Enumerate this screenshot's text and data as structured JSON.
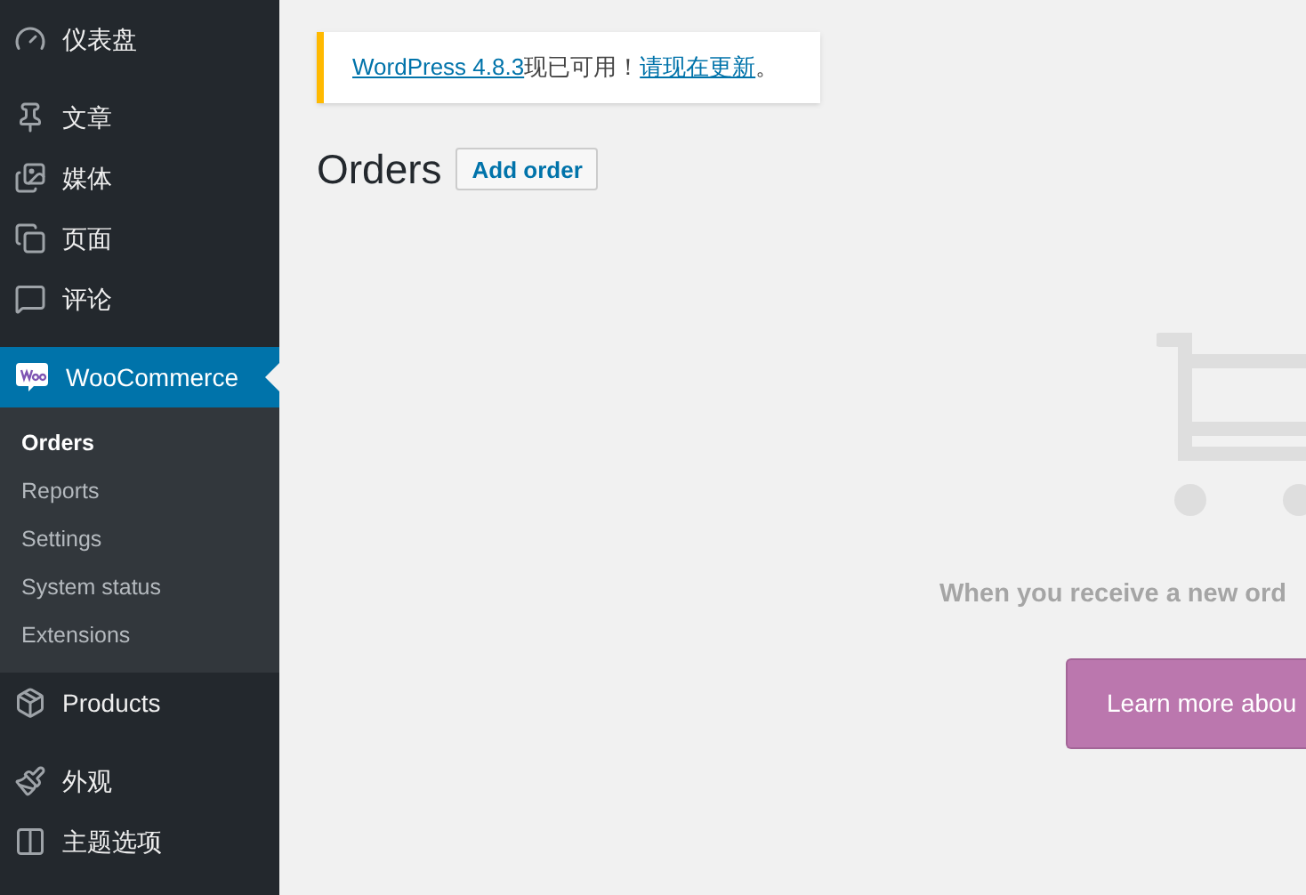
{
  "menu_groups": [
    [
      {
        "label": "仪表盘",
        "selected": false
      }
    ],
    [
      {
        "label": "文章",
        "selected": false
      },
      {
        "label": "媒体",
        "selected": false
      },
      {
        "label": "页面",
        "selected": false
      },
      {
        "label": "评论",
        "selected": false
      }
    ],
    [
      {
        "label": "WooCommerce",
        "selected": true,
        "children": [
          {
            "label": "Orders",
            "selected": true
          },
          {
            "label": "Reports",
            "selected": false
          },
          {
            "label": "Settings",
            "selected": false
          },
          {
            "label": "System status",
            "selected": false
          },
          {
            "label": "Extensions",
            "selected": false
          }
        ]
      },
      {
        "label": "Products",
        "selected": false
      }
    ],
    [
      {
        "label": "外观",
        "selected": false
      },
      {
        "label": "主题选项",
        "selected": false
      }
    ]
  ],
  "notice": {
    "link": "WordPress 4.8.3",
    "text": "现已可用！",
    "action": "请现在更新",
    "end": "。"
  },
  "page_title": "Orders",
  "add_button": "Add order",
  "empty_state": {
    "message": "When you receive a new ord",
    "button": "Learn more abou"
  }
}
